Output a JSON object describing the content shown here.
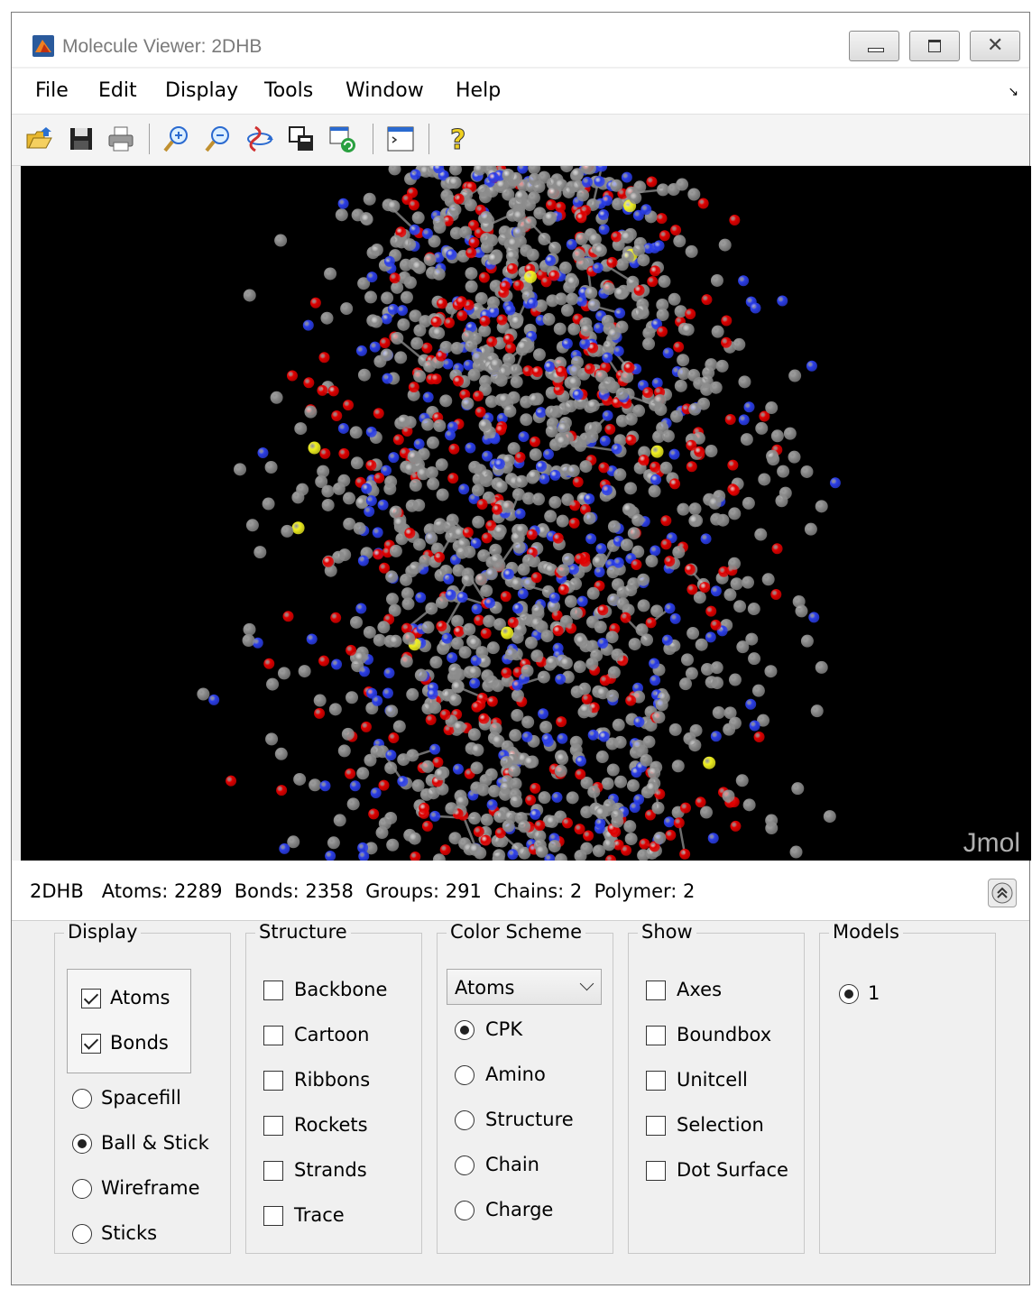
{
  "window": {
    "title": "Molecule Viewer: 2DHB"
  },
  "menu": {
    "items": [
      "File",
      "Edit",
      "Display",
      "Tools",
      "Window",
      "Help"
    ]
  },
  "toolbar": {
    "icons": [
      "open-icon",
      "save-icon",
      "print-icon",
      "zoom-in-icon",
      "zoom-out-icon",
      "rotate-icon",
      "copy-figure-icon",
      "refresh-icon",
      "command-window-icon",
      "help-icon"
    ]
  },
  "viewer": {
    "watermark": "Jmol",
    "background": "#000000",
    "atom_colors": {
      "carbon": "#8c8c8c",
      "oxygen": "#e00000",
      "nitrogen": "#2b3ee8",
      "sulfur": "#f0f020"
    }
  },
  "info": {
    "text": "2DHB   Atoms: 2289  Bonds: 2358  Groups: 291  Chains: 2  Polymer: 2"
  },
  "panels": {
    "display": {
      "title": "Display",
      "checkboxes": [
        {
          "label": "Atoms",
          "checked": true
        },
        {
          "label": "Bonds",
          "checked": true
        }
      ],
      "radios": [
        {
          "label": "Spacefill",
          "selected": false
        },
        {
          "label": "Ball & Stick",
          "selected": true
        },
        {
          "label": "Wireframe",
          "selected": false
        },
        {
          "label": "Sticks",
          "selected": false
        }
      ]
    },
    "structure": {
      "title": "Structure",
      "checkboxes": [
        {
          "label": "Backbone",
          "checked": false
        },
        {
          "label": "Cartoon",
          "checked": false
        },
        {
          "label": "Ribbons",
          "checked": false
        },
        {
          "label": "Rockets",
          "checked": false
        },
        {
          "label": "Strands",
          "checked": false
        },
        {
          "label": "Trace",
          "checked": false
        }
      ]
    },
    "color_scheme": {
      "title": "Color Scheme",
      "select_value": "Atoms",
      "radios": [
        {
          "label": "CPK",
          "selected": true
        },
        {
          "label": "Amino",
          "selected": false
        },
        {
          "label": "Structure",
          "selected": false
        },
        {
          "label": "Chain",
          "selected": false
        },
        {
          "label": "Charge",
          "selected": false
        }
      ]
    },
    "show": {
      "title": "Show",
      "checkboxes": [
        {
          "label": "Axes",
          "checked": false
        },
        {
          "label": "Boundbox",
          "checked": false
        },
        {
          "label": "Unitcell",
          "checked": false
        },
        {
          "label": "Selection",
          "checked": false
        },
        {
          "label": "Dot Surface",
          "checked": false
        }
      ]
    },
    "models": {
      "title": "Models",
      "radios": [
        {
          "label": "1",
          "selected": true
        }
      ]
    }
  }
}
